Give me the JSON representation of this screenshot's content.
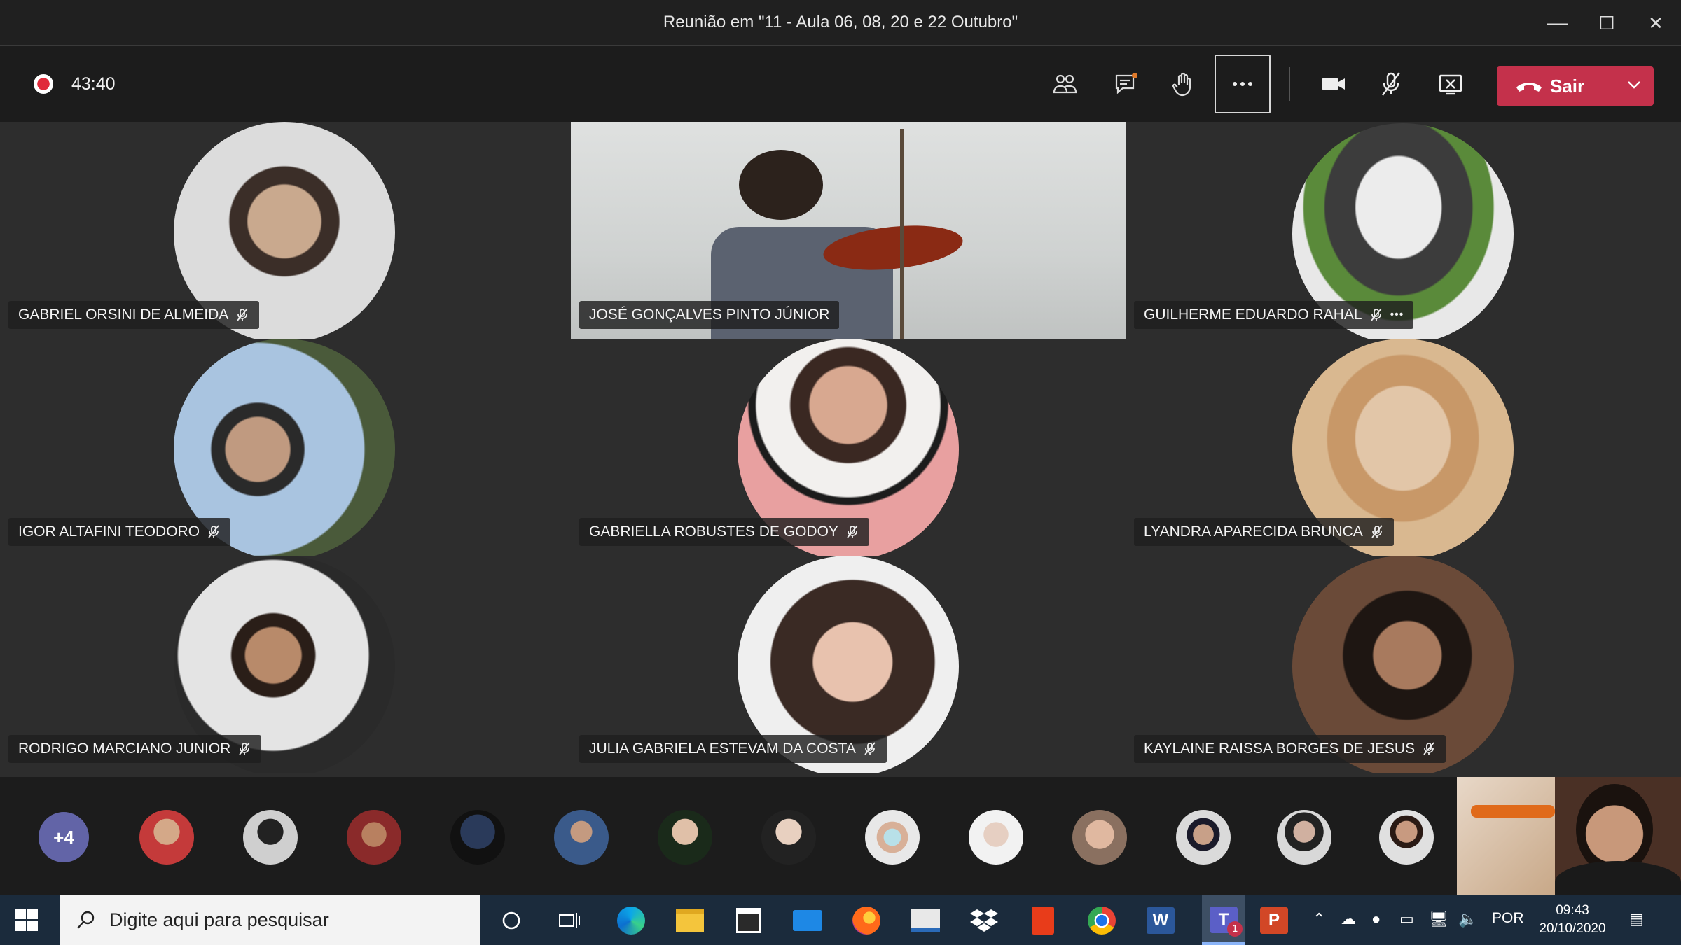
{
  "window": {
    "title": "Reunião em \"11 - Aula 06, 08, 20 e 22 Outubro\"",
    "minimize": "—",
    "maximize": "☐",
    "close": "✕"
  },
  "meeting": {
    "elapsed": "43:40",
    "leave_label": "Sair",
    "leave_color": "#c4314b",
    "toolbar_icons": [
      "participants-icon",
      "chat-icon",
      "raise-hand-icon",
      "more-options-icon",
      "camera-icon",
      "mic-off-icon",
      "stop-share-icon"
    ]
  },
  "participants": [
    {
      "name": "GABRIEL ORSINI DE ALMEIDA",
      "muted": true
    },
    {
      "name": "JOSÉ GONÇALVES PINTO JÚNIOR",
      "muted": false
    },
    {
      "name": "GUILHERME EDUARDO RAHAL",
      "muted": true,
      "more": "•••"
    },
    {
      "name": "IGOR ALTAFINI TEODORO",
      "muted": true
    },
    {
      "name": "GABRIELLA ROBUSTES DE GODOY",
      "muted": true
    },
    {
      "name": "LYANDRA APARECIDA BRUNCA",
      "muted": true
    },
    {
      "name": "RODRIGO MARCIANO JUNIOR",
      "muted": true
    },
    {
      "name": "JULIA GABRIELA ESTEVAM DA COSTA",
      "muted": true
    },
    {
      "name": "KAYLAINE RAISSA BORGES DE JESUS",
      "muted": true
    }
  ],
  "strip": {
    "overflow_count": "+4",
    "avatar_count": 13
  },
  "taskbar": {
    "search_placeholder": "Digite aqui para pesquisar",
    "language": "POR",
    "time": "09:43",
    "date": "20/10/2020",
    "teams_badge": "1"
  }
}
